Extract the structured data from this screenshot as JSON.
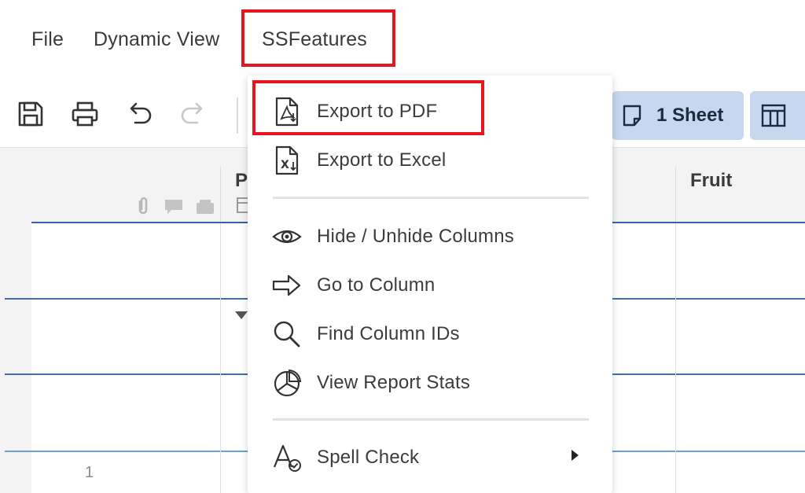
{
  "menubar": {
    "items": [
      {
        "label": "File"
      },
      {
        "label": "Dynamic View"
      },
      {
        "label": "SSFeatures"
      }
    ]
  },
  "toolbar": {
    "icons": [
      "save-icon",
      "print-icon",
      "undo-icon",
      "redo-icon"
    ],
    "sheet_button_label": "1 Sheet"
  },
  "grid": {
    "headers": [
      {
        "label": "P"
      },
      {
        "label": "Fruit"
      }
    ],
    "row_number": "1"
  },
  "dropdown": {
    "items": [
      {
        "label": "Export to PDF",
        "icon": "pdf-file-icon"
      },
      {
        "label": "Export to Excel",
        "icon": "excel-file-icon"
      },
      {
        "label": "Hide / Unhide Columns",
        "icon": "eye-icon"
      },
      {
        "label": "Go to Column",
        "icon": "arrow-right-icon"
      },
      {
        "label": "Find Column IDs",
        "icon": "search-icon"
      },
      {
        "label": "View Report Stats",
        "icon": "pie-chart-icon"
      },
      {
        "label": "Spell Check",
        "icon": "spell-check-icon"
      }
    ]
  },
  "colors": {
    "highlight": "#e8141e",
    "pill": "#c6d7ef",
    "row_line": "#3a6fba"
  }
}
